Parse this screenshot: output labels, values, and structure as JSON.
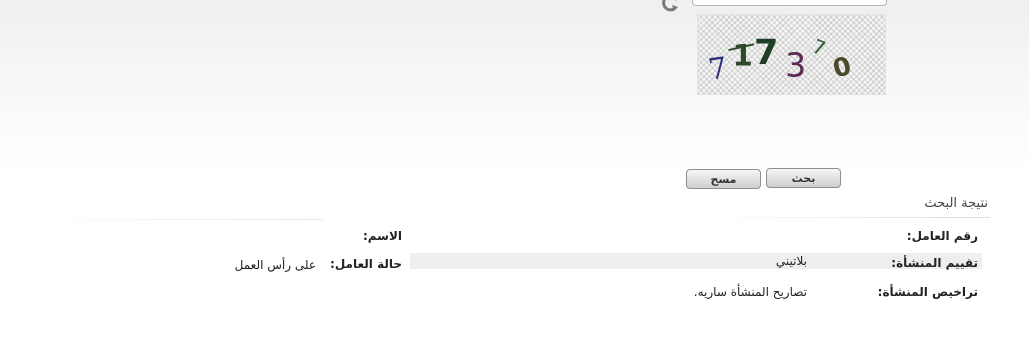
{
  "captcha": {
    "code": "717370",
    "colors": {
      "c1": "#2b2f7a",
      "c2": "#2f4a2a",
      "c3": "#1f3f25",
      "c4": "#5a2a55",
      "c5": "#2f5a2f",
      "c6": "#4a4a2a"
    }
  },
  "buttons": {
    "search_label": "بحث",
    "clear_label": "مسح"
  },
  "result": {
    "title": "نتيجة البحث",
    "worker_number_label": "رقم العامل:",
    "name_label": "الاسم:",
    "facility_rating_label": "تقييم المنشأة:",
    "facility_rating_value": "بلاتيني",
    "worker_status_label": "حالة العامل:",
    "worker_status_value": "على رأس العمل",
    "facility_permits_label": "تراخيص المنشأة:",
    "facility_permits_value": "تصاريح المنشأة ساريه."
  }
}
